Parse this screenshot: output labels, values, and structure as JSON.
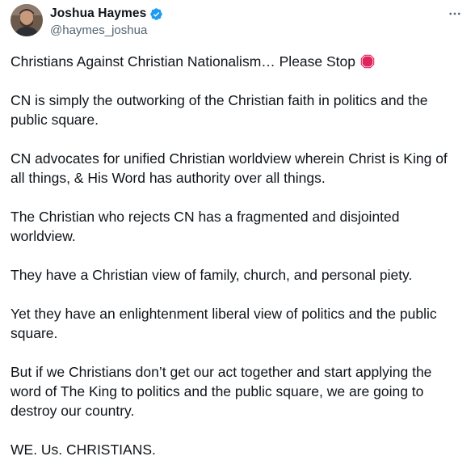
{
  "author": {
    "display_name": "Joshua Haymes",
    "handle": "@haymes_joshua",
    "verified_icon": "verified-badge-icon",
    "verified_color": "#1d9bf0"
  },
  "menu": {
    "icon": "more-horizontal-icon"
  },
  "tweet": {
    "paragraphs": [
      "Christians Against Christian Nationalism… Please Stop",
      "CN is simply the outworking of the Christian faith in politics and the public square.",
      "CN advocates for unified Christian worldview wherein Christ is King of all things, & His Word has authority over all things.",
      "The Christian who rejects CN has a fragmented and disjointed worldview.",
      "They have a Christian view of family, church, and personal piety.",
      "Yet they have an enlightenment liberal view of politics and the public square.",
      "But if we Christians don’t get our act together and start applying the word of The King to politics and the public square, we are going to destroy our country.",
      "WE. Us. CHRISTIANS."
    ],
    "emoji": "stop-sign-icon",
    "emoji_color": "#e0245e"
  }
}
